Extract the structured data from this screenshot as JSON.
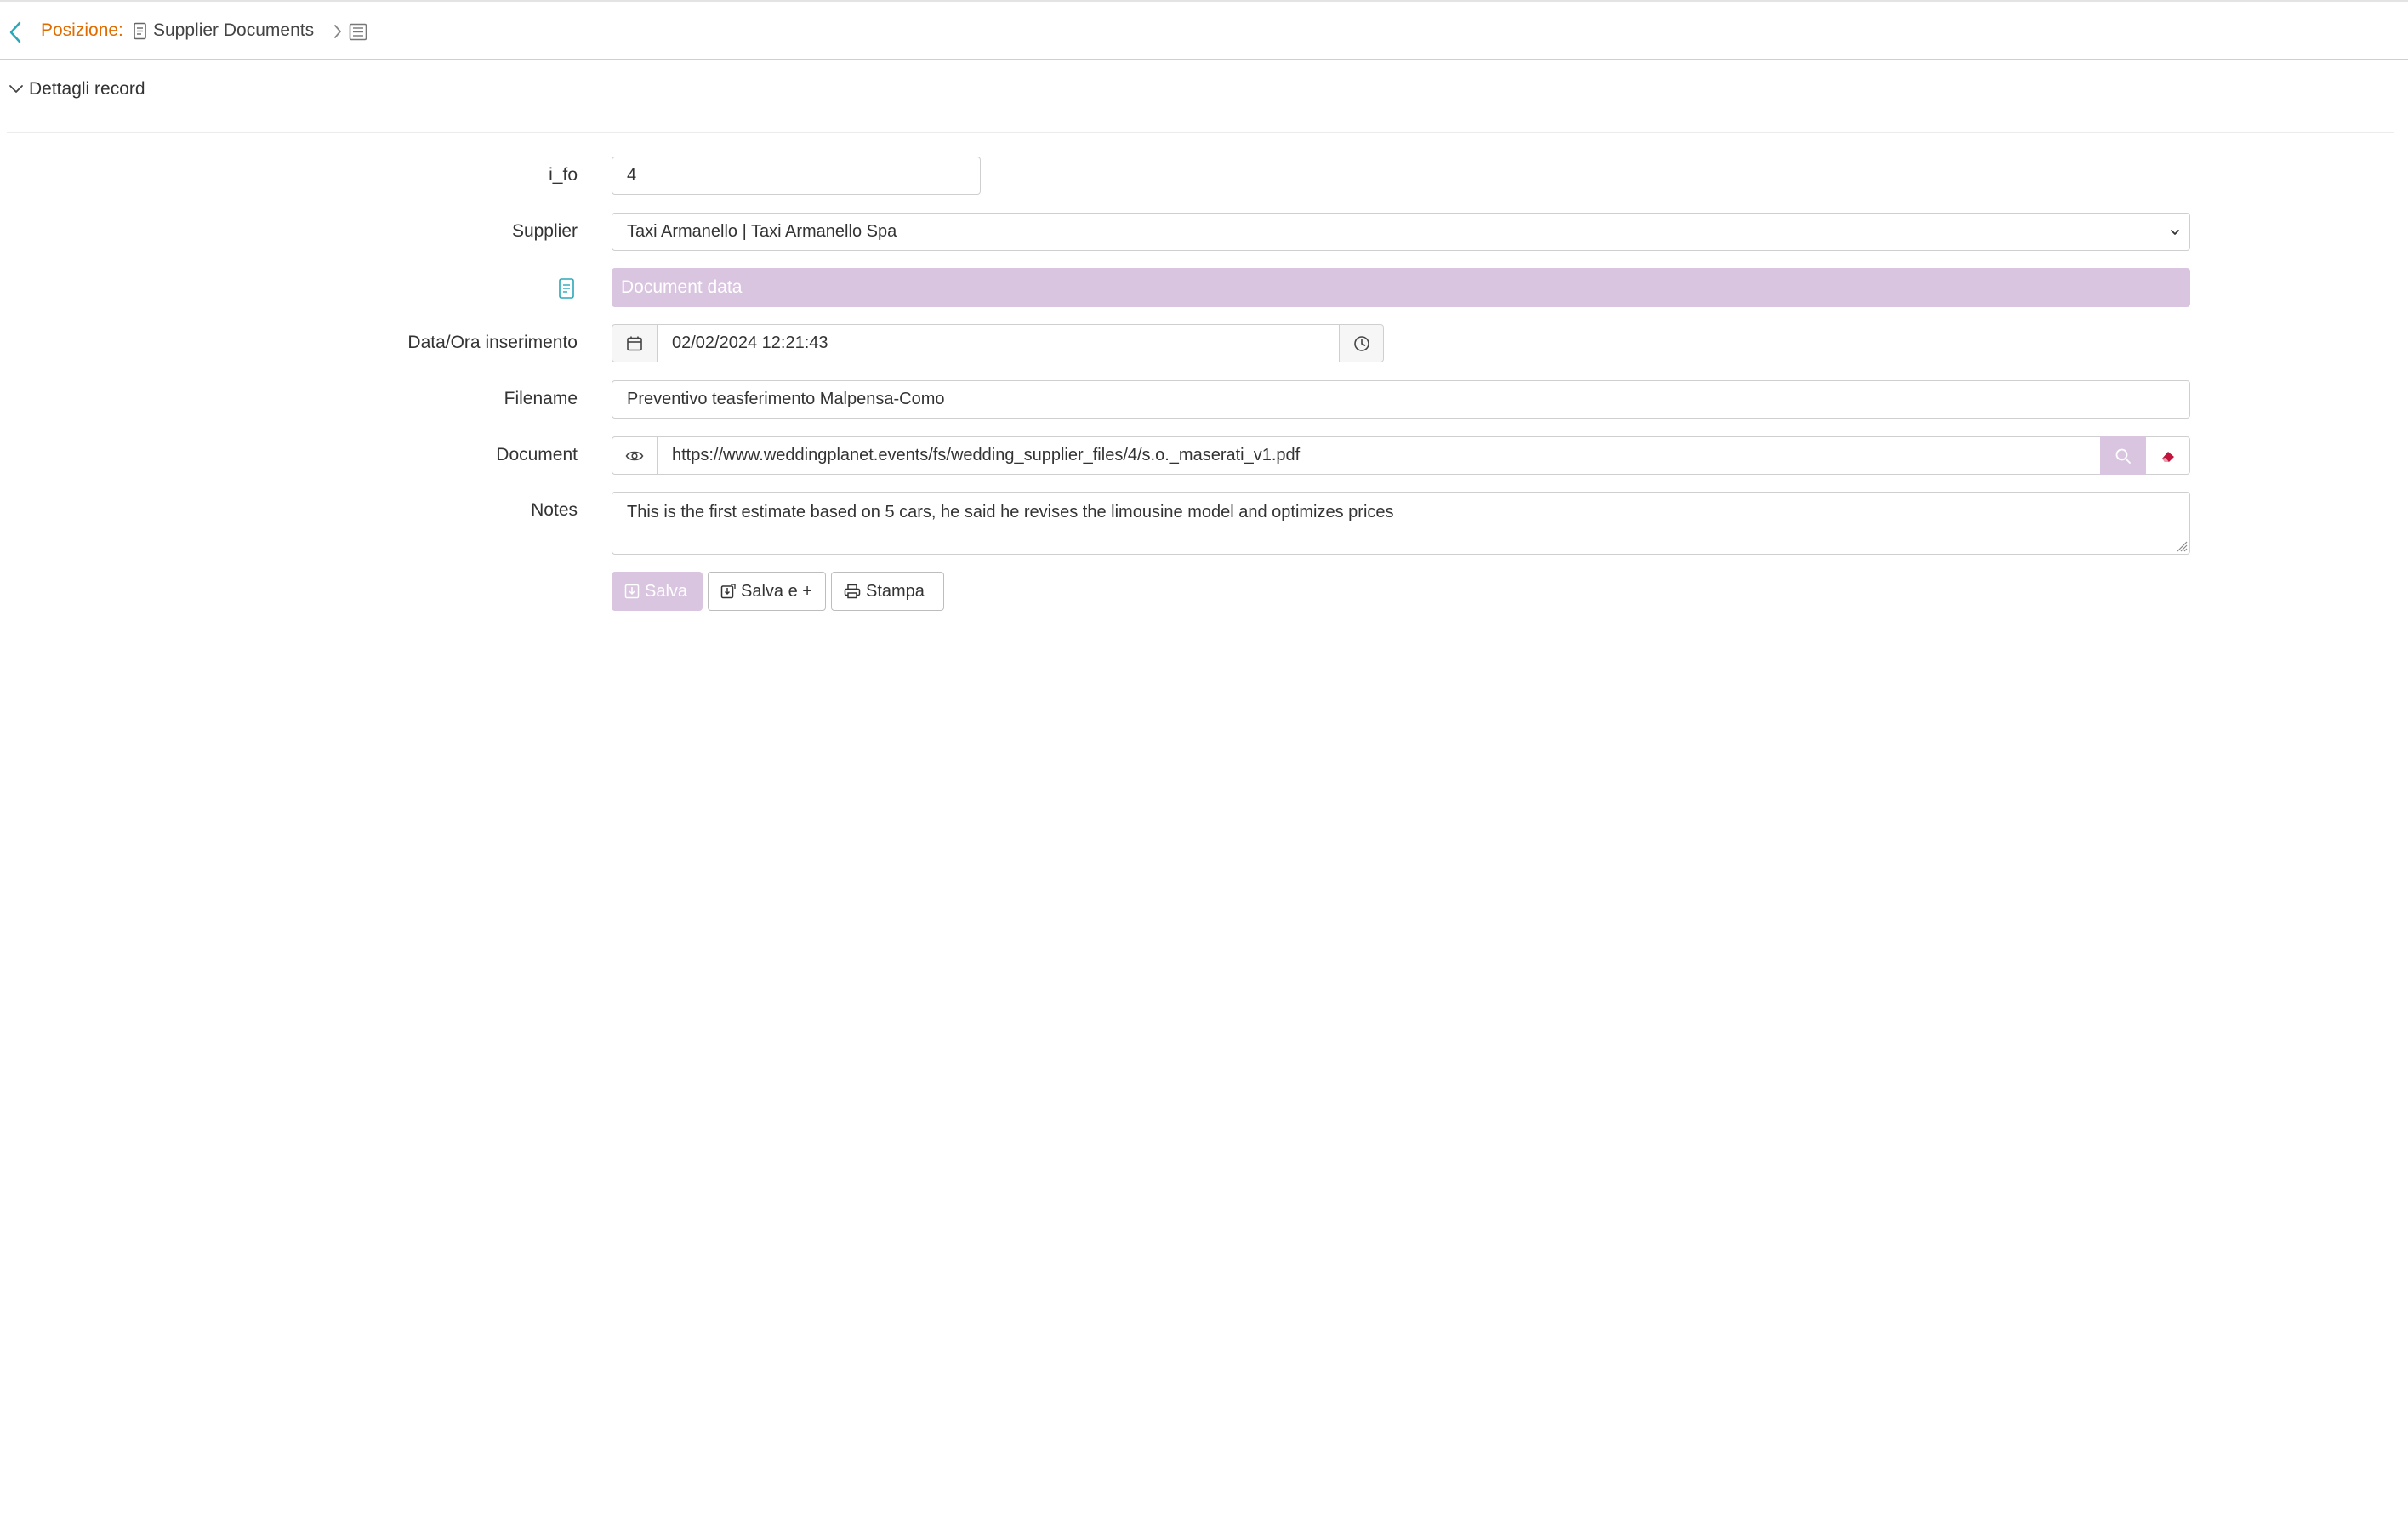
{
  "breadcrumb": {
    "label": "Posizione:",
    "title": "Supplier Documents"
  },
  "section": {
    "title": "Dettagli record"
  },
  "form": {
    "ifo": {
      "label": "i_fo",
      "value": "4"
    },
    "supplier": {
      "label": "Supplier",
      "value": "Taxi Armanello | Taxi Armanello Spa"
    },
    "document_data": {
      "title": "Document data"
    },
    "datetime": {
      "label": "Data/Ora inserimento",
      "value": "02/02/2024 12:21:43"
    },
    "filename": {
      "label": "Filename",
      "value": "Preventivo teasferimento Malpensa-Como"
    },
    "document": {
      "label": "Document",
      "value": "https://www.weddingplanet.events/fs/wedding_supplier_files/4/s.o._maserati_v1.pdf"
    },
    "notes": {
      "label": "Notes",
      "value": "This is the first estimate based on 5 cars, he said he revises the limousine model and optimizes prices"
    }
  },
  "buttons": {
    "save": "Salva",
    "save_new": "Salva e +",
    "print": "Stampa"
  },
  "colors": {
    "accent_orange": "#e06c00",
    "accent_teal": "#2aa8b8",
    "accent_lilac": "#d9c5df",
    "eraser_red": "#c0143c"
  },
  "icons": {
    "back": "chevron-left-icon",
    "document": "document-icon",
    "list": "list-icon",
    "calendar": "calendar-icon",
    "clock": "clock-icon",
    "eye": "eye-icon",
    "search": "search-icon",
    "eraser": "eraser-icon"
  }
}
